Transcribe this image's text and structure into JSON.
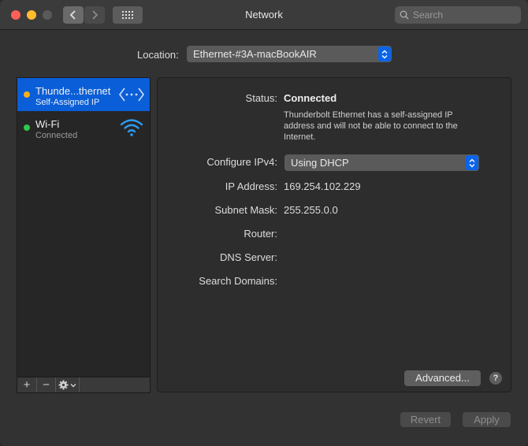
{
  "window": {
    "title": "Network",
    "search_placeholder": "Search"
  },
  "location": {
    "label": "Location:",
    "value": "Ethernet-#3A-macBookAIR"
  },
  "services": [
    {
      "name": "Thunde...thernet",
      "status": "Self-Assigned IP",
      "dot_color": "#f5b01b",
      "icon": "ethernet-arrows-icon",
      "selected": true
    },
    {
      "name": "Wi-Fi",
      "status": "Connected",
      "dot_color": "#2fc84a",
      "icon": "wifi-icon",
      "selected": false
    }
  ],
  "details": {
    "status_label": "Status:",
    "status_value": "Connected",
    "status_description": "Thunderbolt Ethernet has a self-assigned IP address and will not be able to connect to the Internet.",
    "configure_label": "Configure IPv4:",
    "configure_value": "Using DHCP",
    "ip_label": "IP Address:",
    "ip_value": "169.254.102.229",
    "subnet_label": "Subnet Mask:",
    "subnet_value": "255.255.0.0",
    "router_label": "Router:",
    "dns_label": "DNS Server:",
    "search_domains_label": "Search Domains:",
    "advanced_label": "Advanced...",
    "help_label": "?"
  },
  "footer": {
    "add_label": "+",
    "remove_label": "−",
    "revert_label": "Revert",
    "apply_label": "Apply"
  },
  "colors": {
    "accent": "#0a5ed7",
    "wifi_icon": "#2d9cf0"
  }
}
